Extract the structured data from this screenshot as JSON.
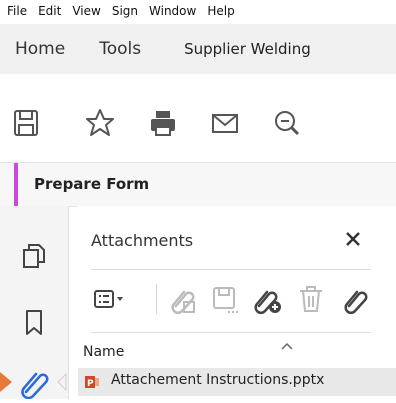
{
  "menu": [
    "File",
    "Edit",
    "View",
    "Sign",
    "Window",
    "Help"
  ],
  "tabs": {
    "home": "Home",
    "tools": "Tools",
    "document": "Supplier Welding"
  },
  "toolbar": {
    "icons": [
      "save-icon",
      "star-icon",
      "print-icon",
      "mail-icon",
      "zoom-out-icon"
    ]
  },
  "prepare_form": {
    "label": "Prepare Form",
    "accent_color": "#c84ad6"
  },
  "left_rail": {
    "icons": [
      "pages-icon",
      "bookmark-icon",
      "paperclip-icon"
    ],
    "active_color": "#2a6ad9"
  },
  "attachments": {
    "title": "Attachments",
    "column_header": "Name",
    "files": [
      {
        "name": "Attachement Instructions.pptx",
        "icon": "powerpoint-file-icon",
        "icon_color": "#d24726"
      }
    ]
  }
}
